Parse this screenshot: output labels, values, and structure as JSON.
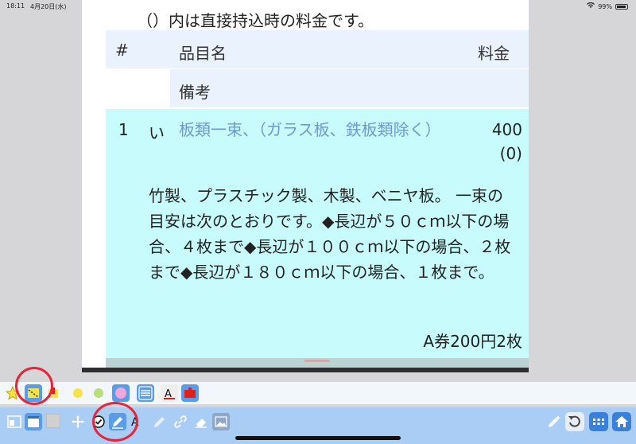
{
  "status_bar": {
    "time": "18:11",
    "date": "4月20日(水)",
    "battery": "99%"
  },
  "document": {
    "note": "（）内は直接持込時の料金です。",
    "header": {
      "num": "#",
      "item": "品目名",
      "price": "料金",
      "remarks": "備考"
    },
    "rows": [
      {
        "num": "1",
        "kana": "い",
        "item": "板類一束、（ガラス板、鉄板類除く）",
        "price": "400",
        "price_direct": "(0)",
        "description": "竹製、プラスチック製、木製、ベニヤ板。 一束の目安は次のとおりです。◆長辺が５０ｃｍ以下の場合、４枚まで◆長辺が１００ｃｍ以下の場合、２枚まで◆長辺が１８０ｃｍ以下の場合、１枚まで。",
        "ticket": "A券200円2枚"
      }
    ]
  },
  "toolbar_top": {
    "tools": [
      "star-icon",
      "yellow-highlight-icon",
      "yellow-marker-icon",
      "yellow-circle-color",
      "green-circle-color",
      "pink-circle-color",
      "lines-icon",
      "text-color-icon",
      "red-box-icon"
    ],
    "colors": {
      "yellow": "#f5e34a",
      "green": "#b8e07a",
      "pink": "#f1a6de",
      "red": "#e0201b"
    }
  },
  "toolbar_bottom": {
    "tools": [
      "layout-icon",
      "window-icon",
      "blank-icon",
      "move-icon",
      "check-icon",
      "pen-icon",
      "text-icon",
      "pencil-icon",
      "link-icon",
      "eraser-icon",
      "image-icon",
      "magic-pen-icon",
      "undo-icon",
      "grid-icon",
      "home-icon"
    ]
  },
  "accent": {
    "selected": "#5a9de6",
    "annotation_circle": "#e8243a"
  }
}
